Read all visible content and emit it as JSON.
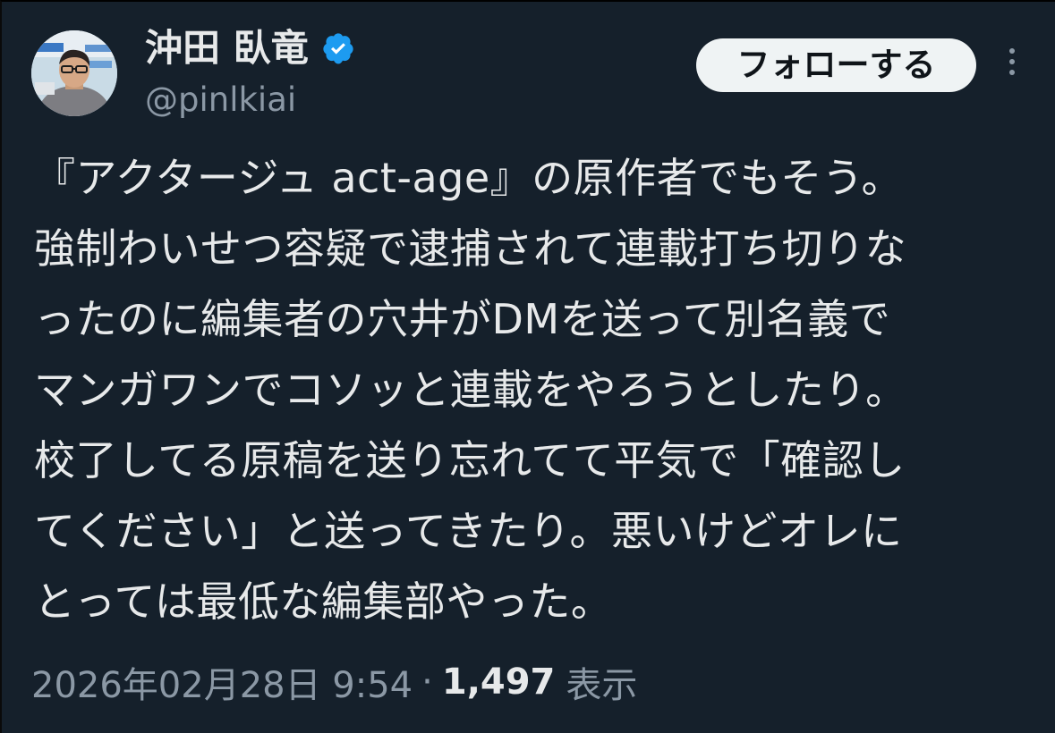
{
  "author": {
    "name": "沖田 臥竜",
    "handle": "@pinlkiai",
    "verified": true
  },
  "follow_button": {
    "label": "フォローする"
  },
  "post": {
    "lines": [
      "『アクタージュ act-age』の原作者でもそう。",
      "強制わいせつ容疑で逮捕されて連載打ち切りな",
      "ったのに編集者の穴井がDMを送って別名義で",
      "マンガワンでコソッと連載をやろうとしたり。",
      "校了してる原稿を送り忘れてて平気で「確認し",
      "てください」と送ってきたり。悪いけどオレに",
      "とっては最低な編集部やった。"
    ]
  },
  "meta": {
    "timestamp": "2026年02月28日 9:54",
    "separator": "·",
    "views_count": "1,497",
    "views_label": "表示"
  },
  "colors": {
    "background": "#15202b",
    "text_primary": "#e7e9ea",
    "text_secondary": "#8b98a5",
    "verified_badge": "#1d9bf0",
    "follow_button_bg": "#eff3f4"
  },
  "icons": {
    "verified": "verified-badge-icon",
    "more": "more-options-icon"
  }
}
